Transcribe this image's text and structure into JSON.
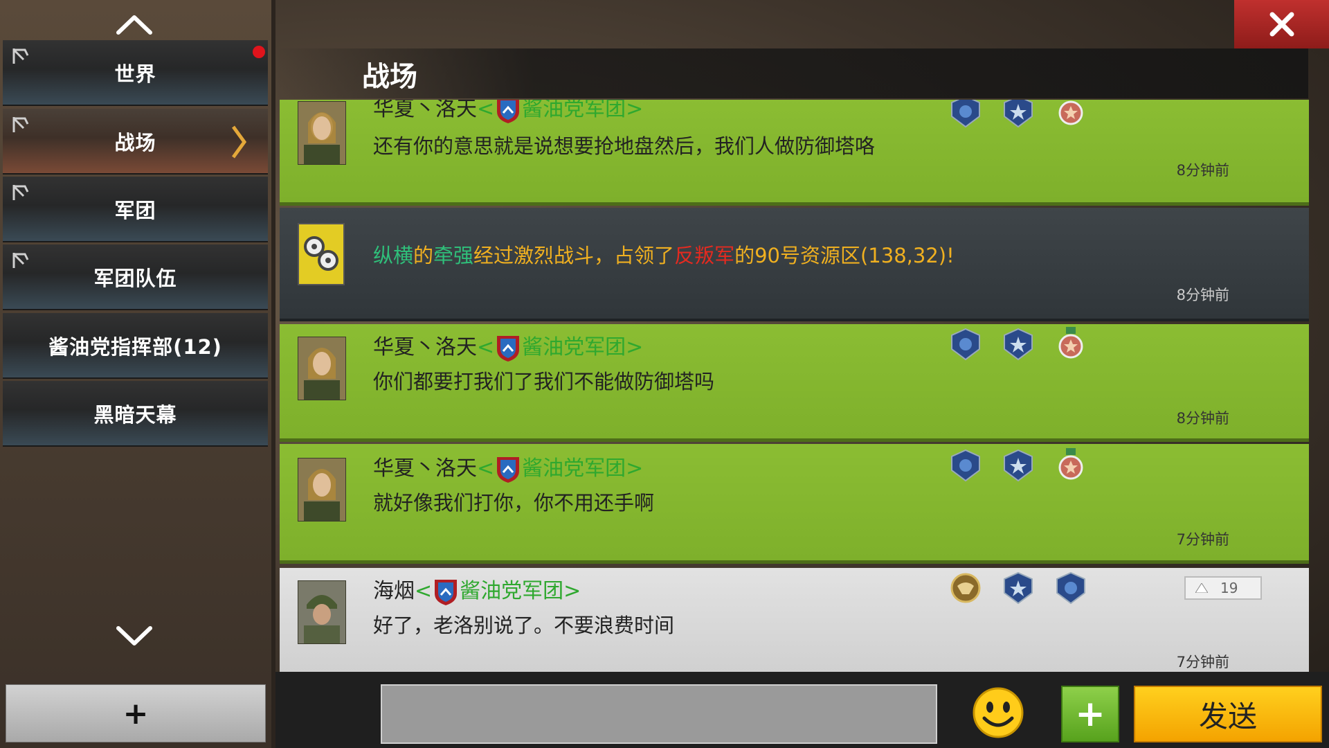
{
  "sidebar": {
    "items": [
      {
        "label": "世界",
        "pinned": true,
        "has_notification": true
      },
      {
        "label": "战场",
        "pinned": true,
        "active": true
      },
      {
        "label": "军团",
        "pinned": true
      },
      {
        "label": "军团队伍",
        "pinned": true
      },
      {
        "label": "酱油党指挥部(12)",
        "pinned": false
      },
      {
        "label": "黑暗天幕",
        "pinned": false
      }
    ],
    "add_label": "+"
  },
  "header": {
    "title": "战场"
  },
  "messages": [
    {
      "type": "player",
      "name": "华夏丶洛天",
      "guild": "酱油党军团",
      "text": "还有你的意思就是说想要抢地盘然后，我们人做防御塔咯",
      "time": "8分钟前"
    },
    {
      "type": "system",
      "parts": [
        "纵横",
        "的",
        "牵强",
        "经过激烈战斗，占领了",
        "反叛军",
        "的90号资源区(138,32)!"
      ],
      "time": "8分钟前"
    },
    {
      "type": "player",
      "name": "华夏丶洛天",
      "guild": "酱油党军团",
      "text": "你们都要打我们了我们不能做防御塔吗",
      "time": "8分钟前"
    },
    {
      "type": "player",
      "name": "华夏丶洛天",
      "guild": "酱油党军团",
      "text": "就好像我们打你，你不用还手啊",
      "time": "7分钟前"
    },
    {
      "type": "player",
      "name": "海烟",
      "guild": "酱油党军团",
      "text": "好了，老洛别说了。不要浪费时间",
      "time": "7分钟前",
      "likes": "19"
    }
  ],
  "input": {
    "placeholder": ""
  },
  "buttons": {
    "send_label": "发送",
    "plus_label": "+"
  },
  "colors": {
    "green_row": "#86b82f",
    "system_row": "#383e42",
    "guild_text": "#2fa82f",
    "name_text": "#222222",
    "send_button": "#f8b710",
    "close_button": "#b22a28"
  }
}
